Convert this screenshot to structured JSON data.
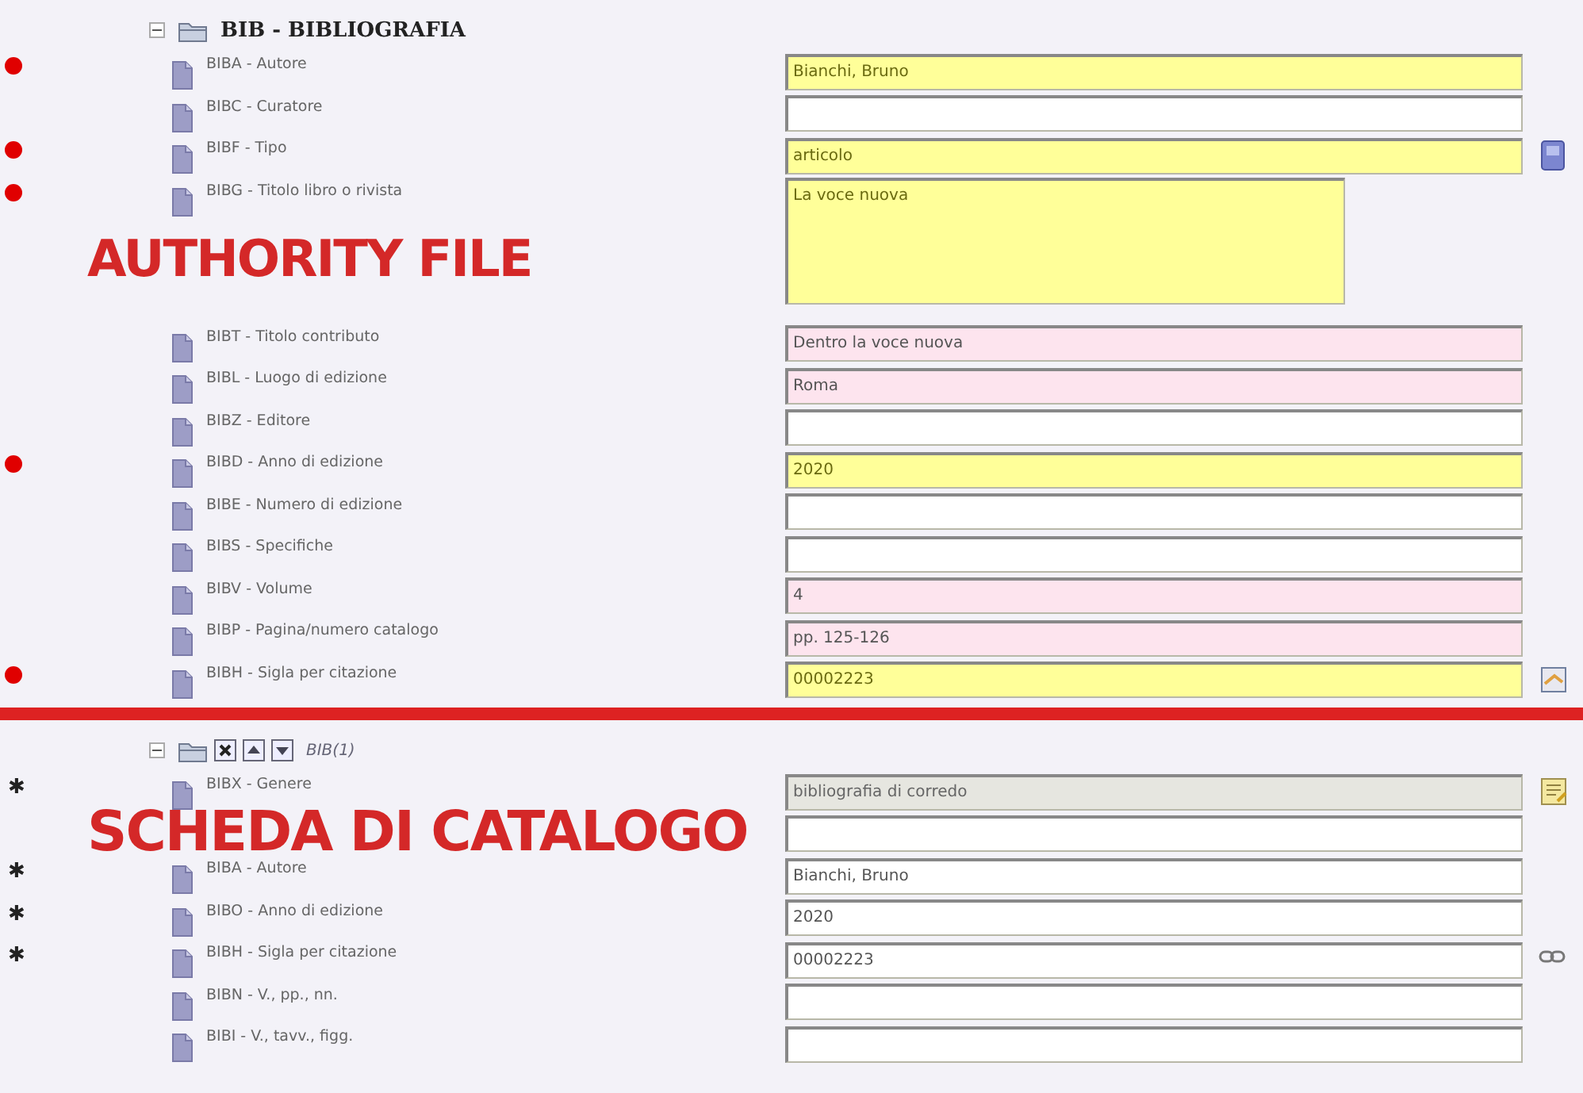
{
  "sections": [
    {
      "header": {
        "title": "BIB - BIBLIOGRAFIA",
        "expanded": true,
        "italic": false
      },
      "rows": [
        {
          "label": "BIBA - Autore",
          "required": true,
          "value": "Bianchi, Bruno",
          "mandatory": true,
          "linked": false,
          "kind": "line"
        },
        {
          "label": "BIBC - Curatore",
          "required": false,
          "value": "",
          "mandatory": false,
          "linked": false,
          "kind": "line"
        },
        {
          "label": "BIBF - Tipo",
          "required": true,
          "value": "articolo",
          "mandatory": true,
          "linked": false,
          "kind": "line",
          "action": {
            "kind": "book"
          }
        },
        {
          "label": "BIBG - Titolo libro o rivista",
          "required": true,
          "value": "La voce nuova",
          "mandatory": true,
          "linked": false,
          "kind": "area",
          "caption": "AUTHORITY FILE"
        },
        {
          "label": "BIBT - Titolo contributo",
          "required": false,
          "value": "Dentro la voce nuova",
          "mandatory": false,
          "linked": true,
          "kind": "line"
        },
        {
          "label": "BIBL - Luogo di edizione",
          "required": false,
          "value": "Roma",
          "mandatory": false,
          "linked": true,
          "kind": "line"
        },
        {
          "label": "BIBZ - Editore",
          "required": false,
          "value": "",
          "mandatory": false,
          "linked": false,
          "kind": "line"
        },
        {
          "label": "BIBD - Anno di edizione",
          "required": true,
          "value": "2020",
          "mandatory": true,
          "linked": false,
          "kind": "line"
        },
        {
          "label": "BIBE - Numero di edizione",
          "required": false,
          "value": "",
          "mandatory": false,
          "linked": false,
          "kind": "line"
        },
        {
          "label": "BIBS - Specifiche",
          "required": false,
          "value": "",
          "mandatory": false,
          "linked": false,
          "kind": "line"
        },
        {
          "label": "BIBV - Volume",
          "required": false,
          "value": "4",
          "mandatory": false,
          "linked": true,
          "kind": "line"
        },
        {
          "label": "BIBP - Pagina/numero catalogo",
          "required": false,
          "value": "pp. 125-126",
          "mandatory": false,
          "linked": true,
          "kind": "line"
        },
        {
          "label": "BIBH - Sigla per citazione",
          "required": true,
          "value": "00002223",
          "mandatory": true,
          "linked": false,
          "kind": "line",
          "action": {
            "kind": "note"
          }
        }
      ]
    },
    {
      "header": {
        "title": "BIB(1)",
        "expanded": true,
        "italic": true,
        "controls": [
          {
            "kind": "remove"
          },
          {
            "kind": "up"
          },
          {
            "kind": "down"
          }
        ]
      },
      "rows": [
        {
          "label": "BIBX - Genere",
          "asterisk": "✱",
          "value": "bibliografia di corredo",
          "disabled": true,
          "kind": "line",
          "action": {
            "kind": "edit"
          }
        },
        {
          "value": "",
          "disabled": false,
          "kind": "line",
          "caption": "SCHEDA DI CATALOGO"
        },
        {
          "label": "BIBA - Autore",
          "asterisk": "✱",
          "value": "Bianchi, Bruno",
          "disabled": false,
          "kind": "line"
        },
        {
          "label": "BIBO - Anno di edizione",
          "asterisk": "✱",
          "value": "2020",
          "disabled": false,
          "kind": "line"
        },
        {
          "label": "BIBH - Sigla per citazione",
          "asterisk": "✱",
          "value": "00002223",
          "disabled": false,
          "kind": "line",
          "action": {
            "kind": "link"
          }
        },
        {
          "label": "BIBN - V., pp., nn.",
          "value": "",
          "disabled": false,
          "kind": "line"
        },
        {
          "label": "BIBI - V., tavv., figg.",
          "value": "",
          "disabled": false,
          "kind": "line"
        }
      ]
    }
  ]
}
